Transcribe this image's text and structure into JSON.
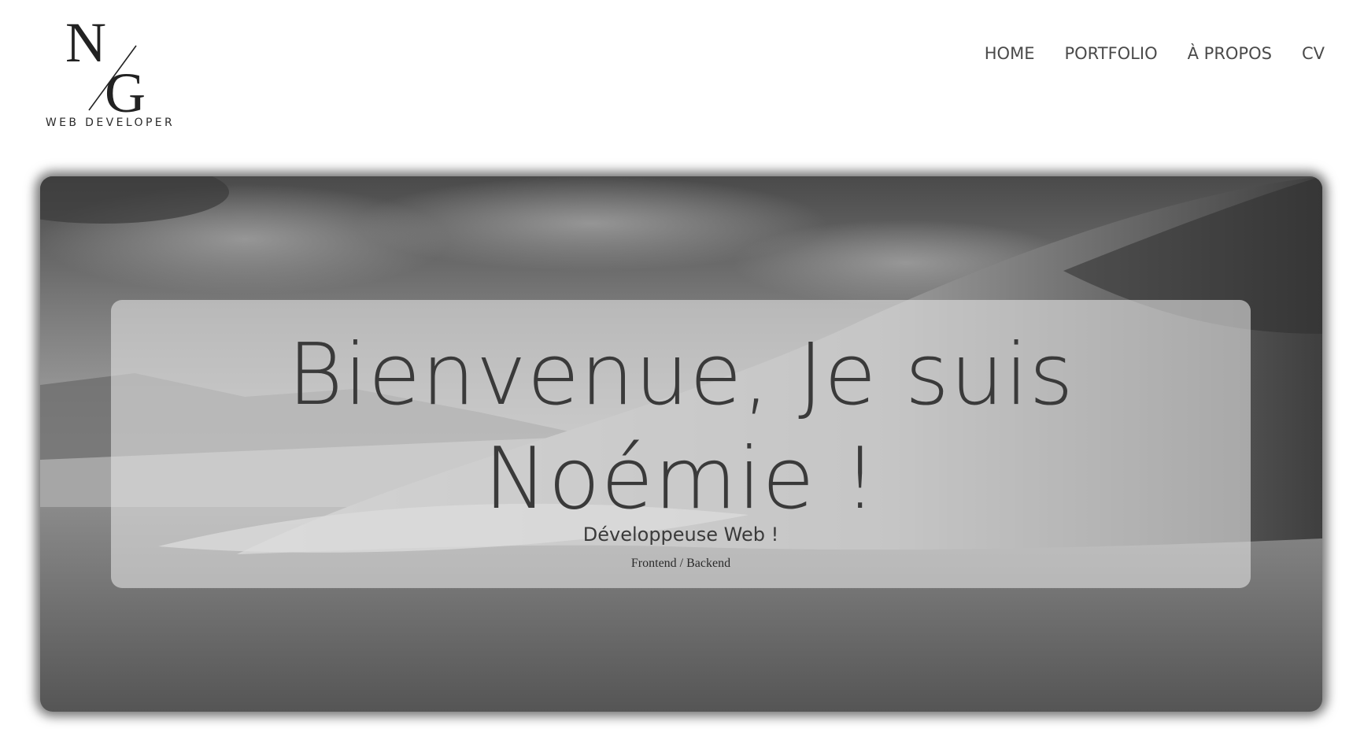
{
  "logo": {
    "letter_1": "N",
    "letter_2": "G",
    "tagline": "WEB DEVELOPER"
  },
  "nav": {
    "items": [
      {
        "label": "HOME"
      },
      {
        "label": "PORTFOLIO"
      },
      {
        "label": "À PROPOS"
      },
      {
        "label": "CV"
      }
    ]
  },
  "hero": {
    "title_line_1": "Bienvenue, Je suis",
    "title_line_2": "Noémie !",
    "subtitle": "Développeuse Web !",
    "tagline": "Frontend / Backend",
    "background_image": "grayscale-ocean-wave"
  },
  "colors": {
    "text_dark": "#3a3a3a",
    "nav_text": "#4a4a4a",
    "card_overlay": "#e1e1e1"
  }
}
